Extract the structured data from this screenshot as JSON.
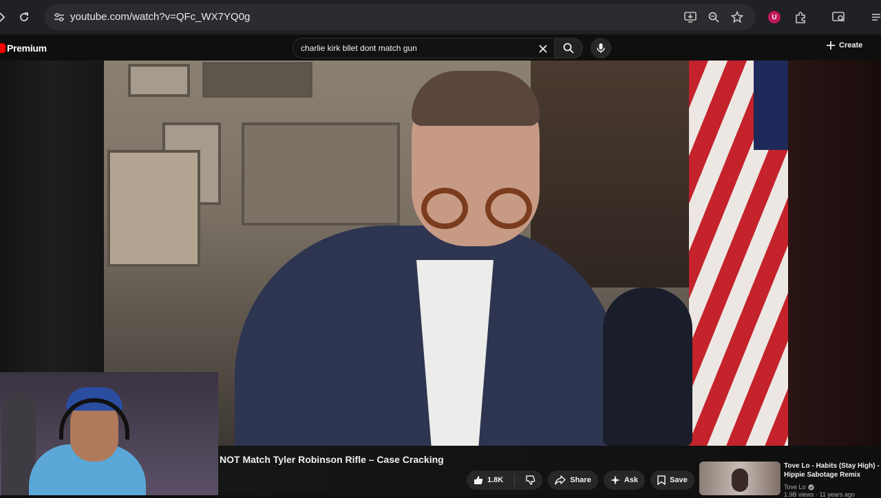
{
  "browser": {
    "url": "youtube.com/watch?v=QFc_WX7YQ0g"
  },
  "youtube": {
    "logo_text": "Premium",
    "search_query": "charlie kirk bllet dont match gun",
    "create_label": "Create"
  },
  "video": {
    "title": "NOT Match Tyler Robinson Rifle – Case Cracking",
    "likes": "1.8K",
    "share_label": "Share",
    "ask_label": "Ask",
    "save_label": "Save"
  },
  "recommendation": {
    "title": "Tove Lo - Habits (Stay High) - Hippie Sabotage Remix",
    "channel": "Tove Lo",
    "meta": "1.9B views · 11 years ago"
  },
  "colors": {
    "brand": "#ff0000",
    "extension_badge": "#c2185b"
  }
}
